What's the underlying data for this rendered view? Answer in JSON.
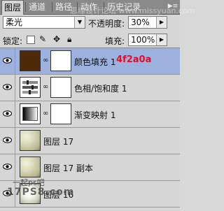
{
  "tabs": [
    {
      "label": "图层",
      "active": true
    },
    {
      "label": "通道",
      "active": false
    },
    {
      "label": "路径",
      "active": false
    },
    {
      "label": "动作",
      "active": false
    },
    {
      "label": "历史记录",
      "active": false
    }
  ],
  "watermark_top": "思缘设计论坛 www.missyuan.com",
  "blend_mode": {
    "value": "柔光"
  },
  "opacity": {
    "label": "不透明度:",
    "value": "30%"
  },
  "lock": {
    "label": "锁定:"
  },
  "fill": {
    "label": "填充:",
    "value": "100%"
  },
  "layers": [
    {
      "name": "颜色填充 1",
      "selected": true,
      "note": "4f2a0a",
      "fill_color": "#4f2a0a"
    },
    {
      "name": "色相/饱和度 1",
      "selected": false
    },
    {
      "name": "渐变映射 1",
      "selected": false
    },
    {
      "name": "图层 17",
      "selected": false
    },
    {
      "name": "图层 17 副本",
      "selected": false
    },
    {
      "name": "图层 16",
      "selected": false
    }
  ],
  "watermark": {
    "line1": "一起ps吧",
    "line2": "17PS8.com"
  },
  "colors": {
    "selected_row": "#9db1df",
    "note_red": "#e0102a"
  }
}
